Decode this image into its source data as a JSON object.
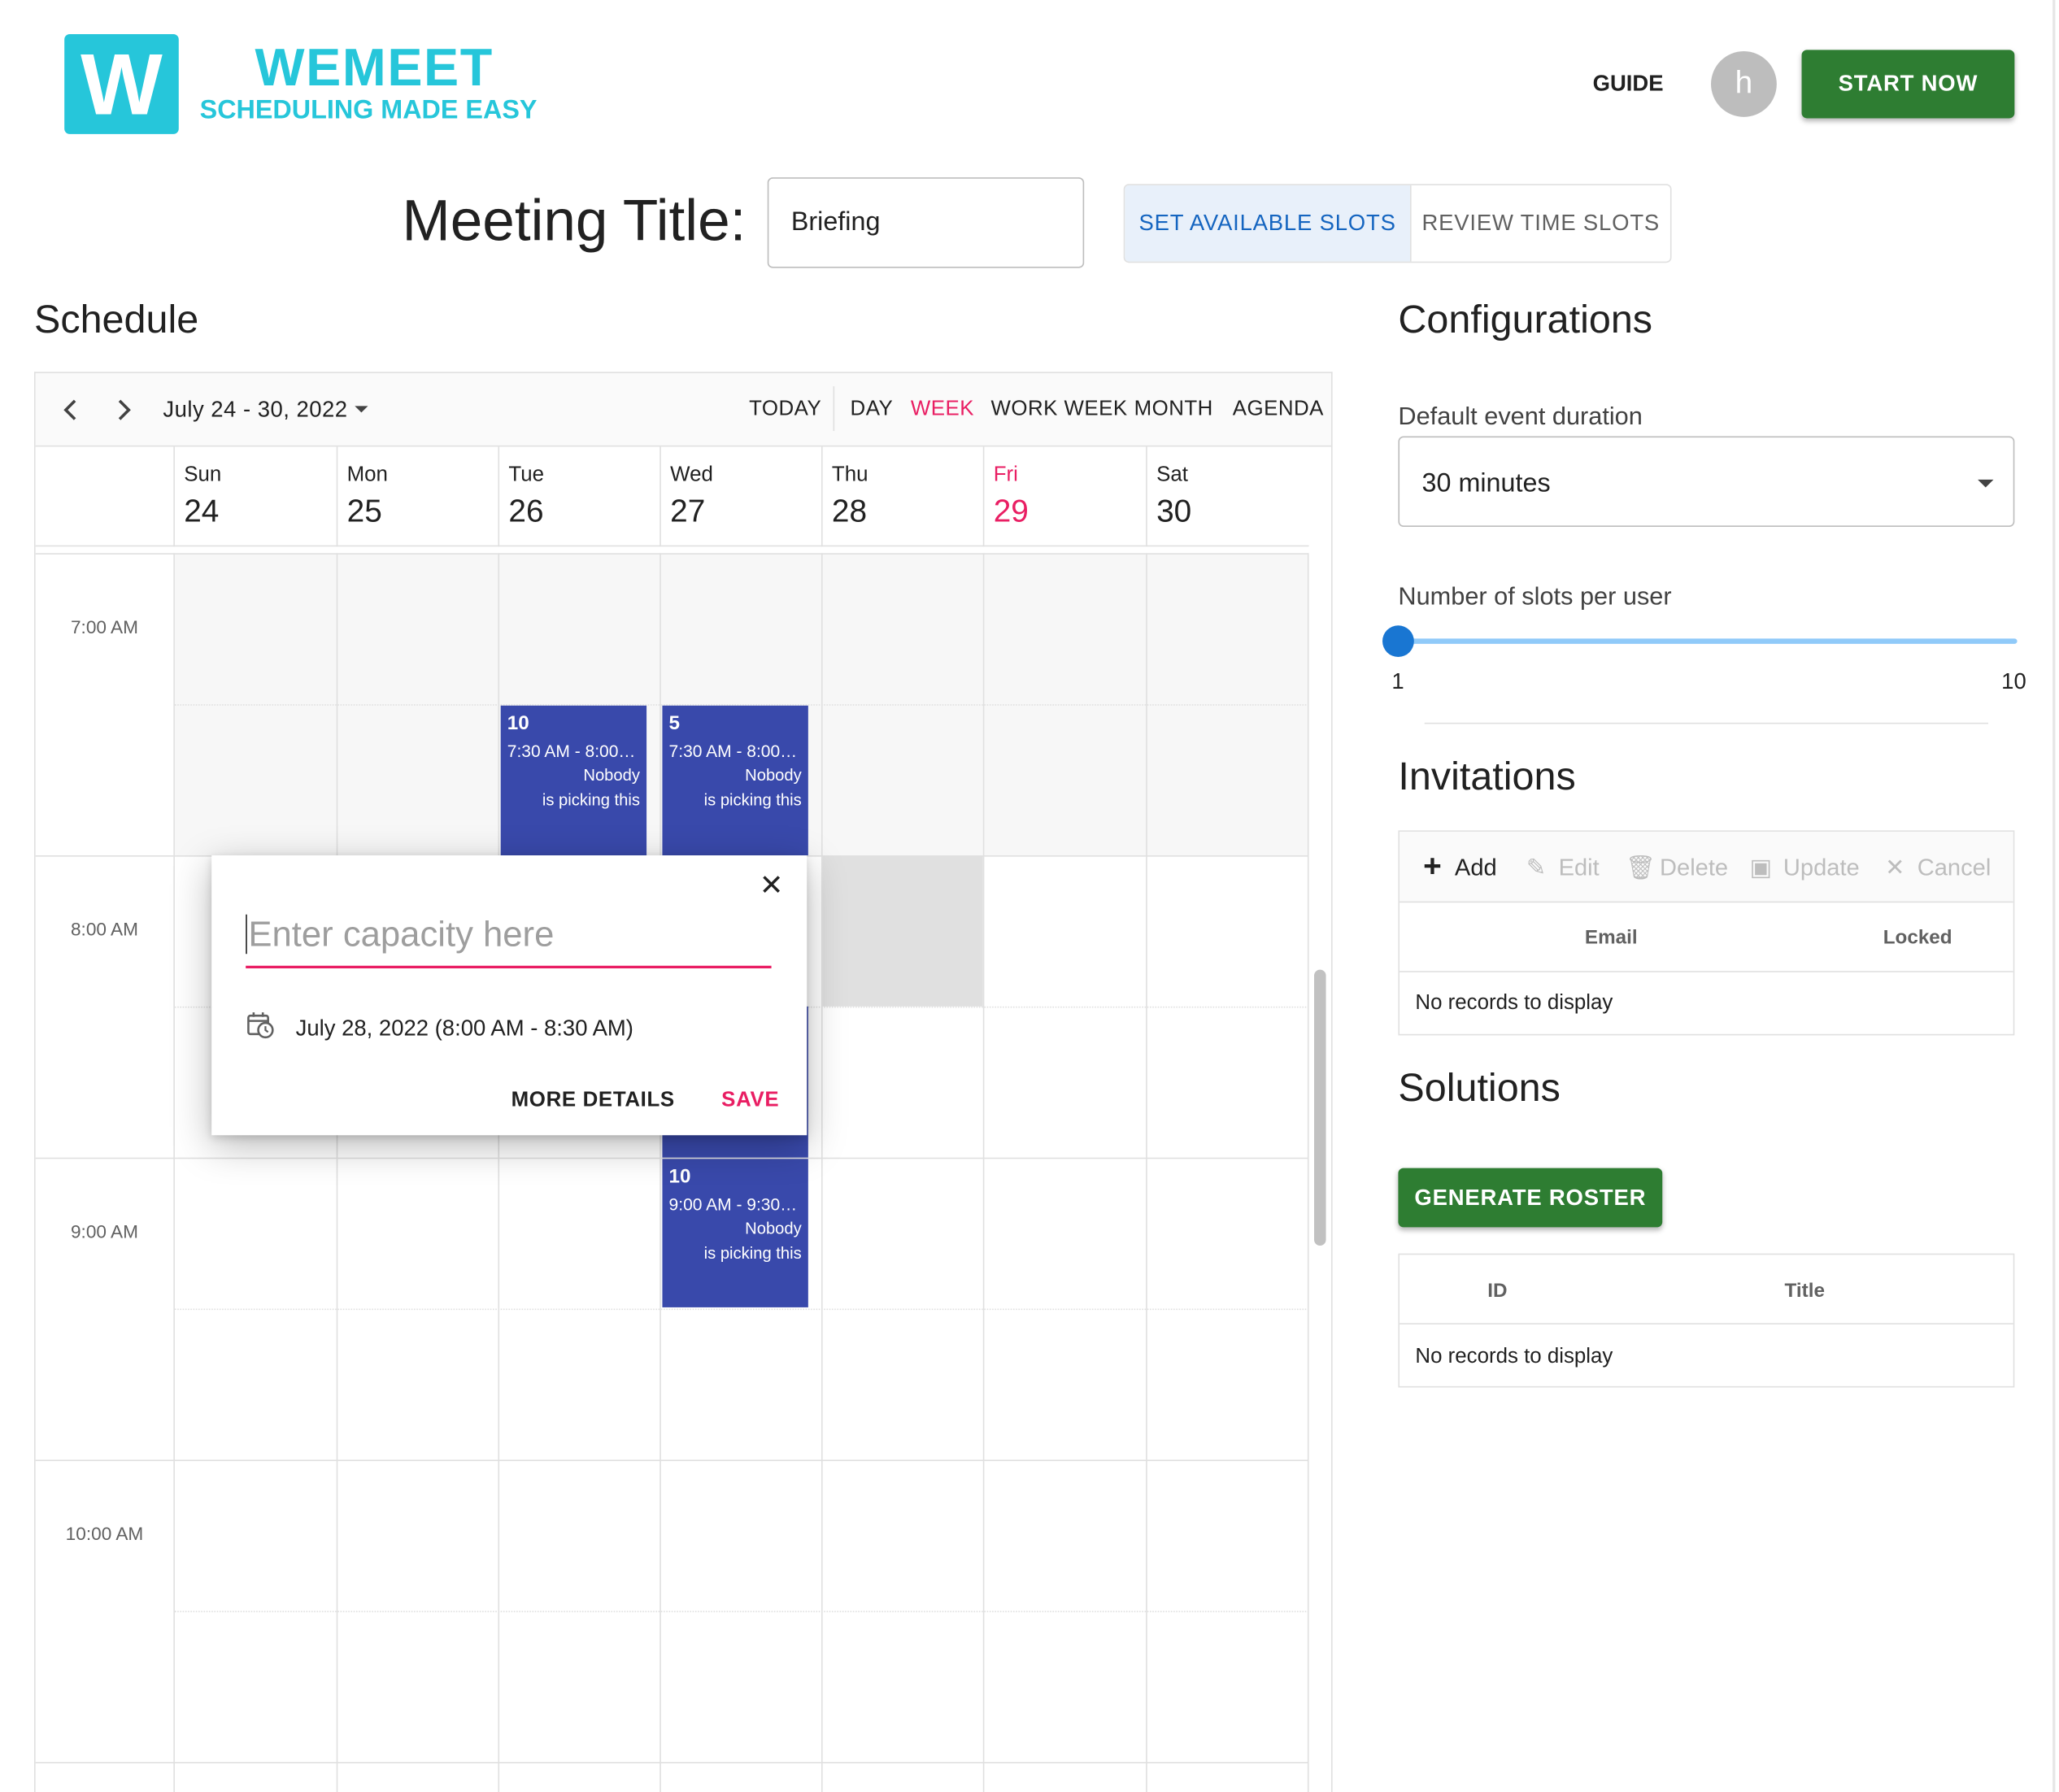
{
  "header": {
    "logo_letter": "W",
    "brand_name": "WEMEET",
    "tagline": "SCHEDULING MADE EASY",
    "guide_label": "GUIDE",
    "avatar_letter": "h",
    "start_label": "START NOW"
  },
  "meeting": {
    "label": "Meeting Title:",
    "title_value": "Briefing",
    "tabs": [
      "SET AVAILABLE SLOTS",
      "REVIEW TIME SLOTS"
    ],
    "active_tab": "SET AVAILABLE SLOTS"
  },
  "schedule": {
    "section_title": "Schedule",
    "date_range": "July 24 - 30, 2022",
    "toolbar": {
      "today": "TODAY",
      "views": [
        "DAY",
        "WEEK",
        "WORK WEEK",
        "MONTH",
        "AGENDA"
      ],
      "active_view": "WEEK"
    },
    "days": [
      {
        "name": "Sun",
        "num": "24"
      },
      {
        "name": "Mon",
        "num": "25"
      },
      {
        "name": "Tue",
        "num": "26"
      },
      {
        "name": "Wed",
        "num": "27"
      },
      {
        "name": "Thu",
        "num": "28"
      },
      {
        "name": "Fri",
        "num": "29"
      },
      {
        "name": "Sat",
        "num": "30"
      }
    ],
    "highlighted_day": "Fri",
    "times": [
      "7:00 AM",
      "8:00 AM",
      "9:00 AM",
      "10:00 AM"
    ],
    "events": [
      {
        "day": "Tue",
        "title": "10",
        "time": "7:30 AM - 8:00…",
        "line1": "Nobody",
        "line2": "is picking this"
      },
      {
        "day": "Wed",
        "title": "5",
        "time": "7:30 AM - 8:00…",
        "line1": "Nobody",
        "line2": "is picking this"
      },
      {
        "day": "Wed",
        "title": "10",
        "time": "9:00 AM - 9:30…",
        "line1": "Nobody",
        "line2": "is picking this"
      }
    ],
    "event_color": "#3949ab"
  },
  "popover": {
    "placeholder": "Enter capacity here",
    "date_text": "July 28, 2022 (8:00 AM - 8:30 AM)",
    "more_details": "MORE DETAILS",
    "save": "SAVE"
  },
  "configurations": {
    "section_title": "Configurations",
    "duration_label": "Default event duration",
    "duration_value": "30 minutes",
    "slots_label": "Number of slots per user",
    "slots_min": "1",
    "slots_max": "10",
    "slots_value": 1
  },
  "invitations": {
    "section_title": "Invitations",
    "toolbar": [
      "Add",
      "Edit",
      "Delete",
      "Update",
      "Cancel"
    ],
    "columns": [
      "Email",
      "Locked"
    ],
    "empty_text": "No records to display"
  },
  "solutions": {
    "section_title": "Solutions",
    "generate_label": "GENERATE ROSTER",
    "columns": [
      "ID",
      "Title"
    ],
    "empty_text": "No records to display"
  },
  "colors": {
    "brand": "#26c6da",
    "primary_green": "#2e7d32",
    "accent_pink": "#e91e63",
    "active_tab_blue": "#1565c0"
  }
}
